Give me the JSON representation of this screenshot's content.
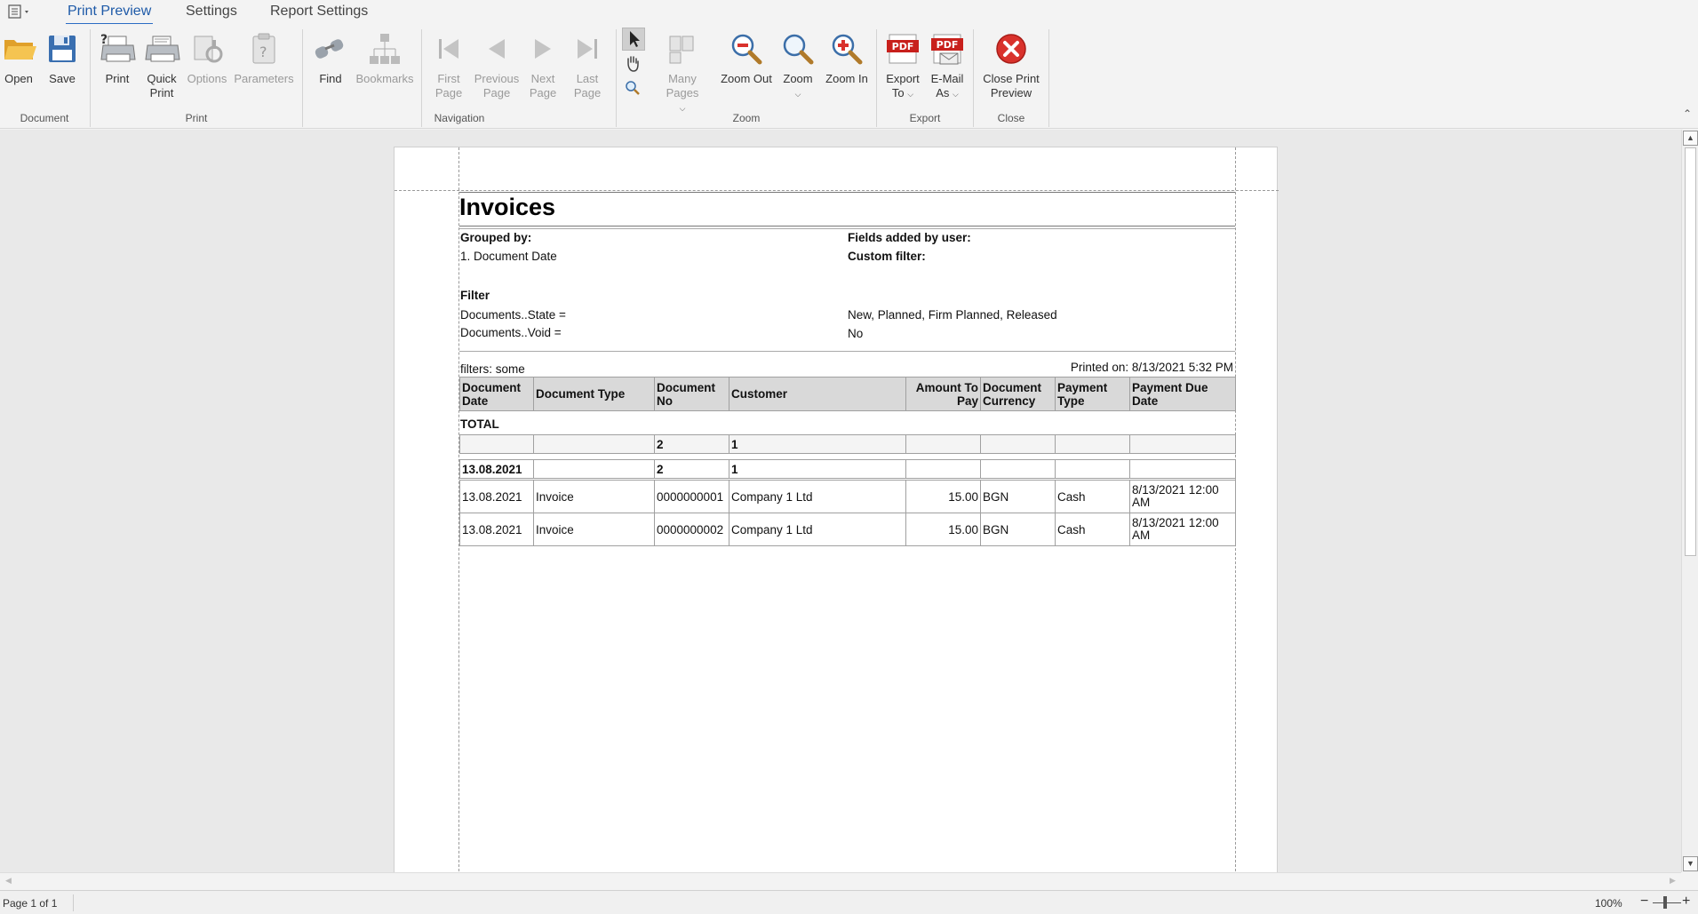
{
  "tabs": [
    "Print Preview",
    "Settings",
    "Report Settings"
  ],
  "ribbon": {
    "document": {
      "label": "Document",
      "open": "Open",
      "save": "Save"
    },
    "print": {
      "label": "Print",
      "print": "Print",
      "quick_print": "Quick\nPrint",
      "options": "Options",
      "parameters": "Parameters"
    },
    "navigation": {
      "label": "Navigation",
      "find": "Find",
      "bookmarks": "Bookmarks",
      "first_page": "First\nPage",
      "previous_page": "Previous\nPage",
      "next_page": "Next\nPage",
      "last_page": "Last\nPage"
    },
    "zoom": {
      "label": "Zoom",
      "many_pages": "Many Pages",
      "zoom_out": "Zoom Out",
      "zoom": "Zoom",
      "zoom_in": "Zoom In"
    },
    "export": {
      "label": "Export",
      "export_to": "Export\nTo",
      "email_as": "E-Mail\nAs"
    },
    "close": {
      "label": "Close",
      "close_preview": "Close Print\nPreview"
    },
    "pdf_badge": "PDF"
  },
  "report": {
    "title": "Invoices",
    "grouped_by_label": "Grouped by:",
    "grouped_by_value": "1. Document Date",
    "fields_added_label": "Fields added by user:",
    "custom_filter_label": "Custom filter:",
    "filter_label": "Filter",
    "filters": [
      {
        "name": "Documents..State =",
        "value": "New, Planned, Firm Planned, Released"
      },
      {
        "name": "Documents..Void =",
        "value": "No"
      }
    ],
    "filters_note": "filters: some",
    "printed_on": "Printed on: 8/13/2021 5:32 PM",
    "columns": [
      "Document Date",
      "Document Type",
      "Document No",
      "Customer",
      "Amount To Pay",
      "Document Currency",
      "Payment Type",
      "Payment Due Date"
    ],
    "total_label": "TOTAL",
    "total_row": [
      "",
      "",
      "2",
      "1",
      "",
      "",
      "",
      ""
    ],
    "group_row": [
      "13.08.2021",
      "",
      "2",
      "1",
      "",
      "",
      "",
      ""
    ],
    "rows": [
      [
        "13.08.2021",
        "Invoice",
        "0000000001",
        "Company 1 Ltd",
        "15.00",
        "BGN",
        "Cash",
        "8/13/2021 12:00 AM"
      ],
      [
        "13.08.2021",
        "Invoice",
        "0000000002",
        "Company 1 Ltd",
        "15.00",
        "BGN",
        "Cash",
        "8/13/2021 12:00 AM"
      ]
    ]
  },
  "status": {
    "page_info": "Page 1 of 1",
    "zoom": "100%"
  },
  "colors": {
    "accent": "#2b6cc4",
    "close_red": "#d9322c",
    "pdf_red": "#c8201c",
    "folder": "#f0b43a",
    "floppy": "#3a6fb0"
  }
}
